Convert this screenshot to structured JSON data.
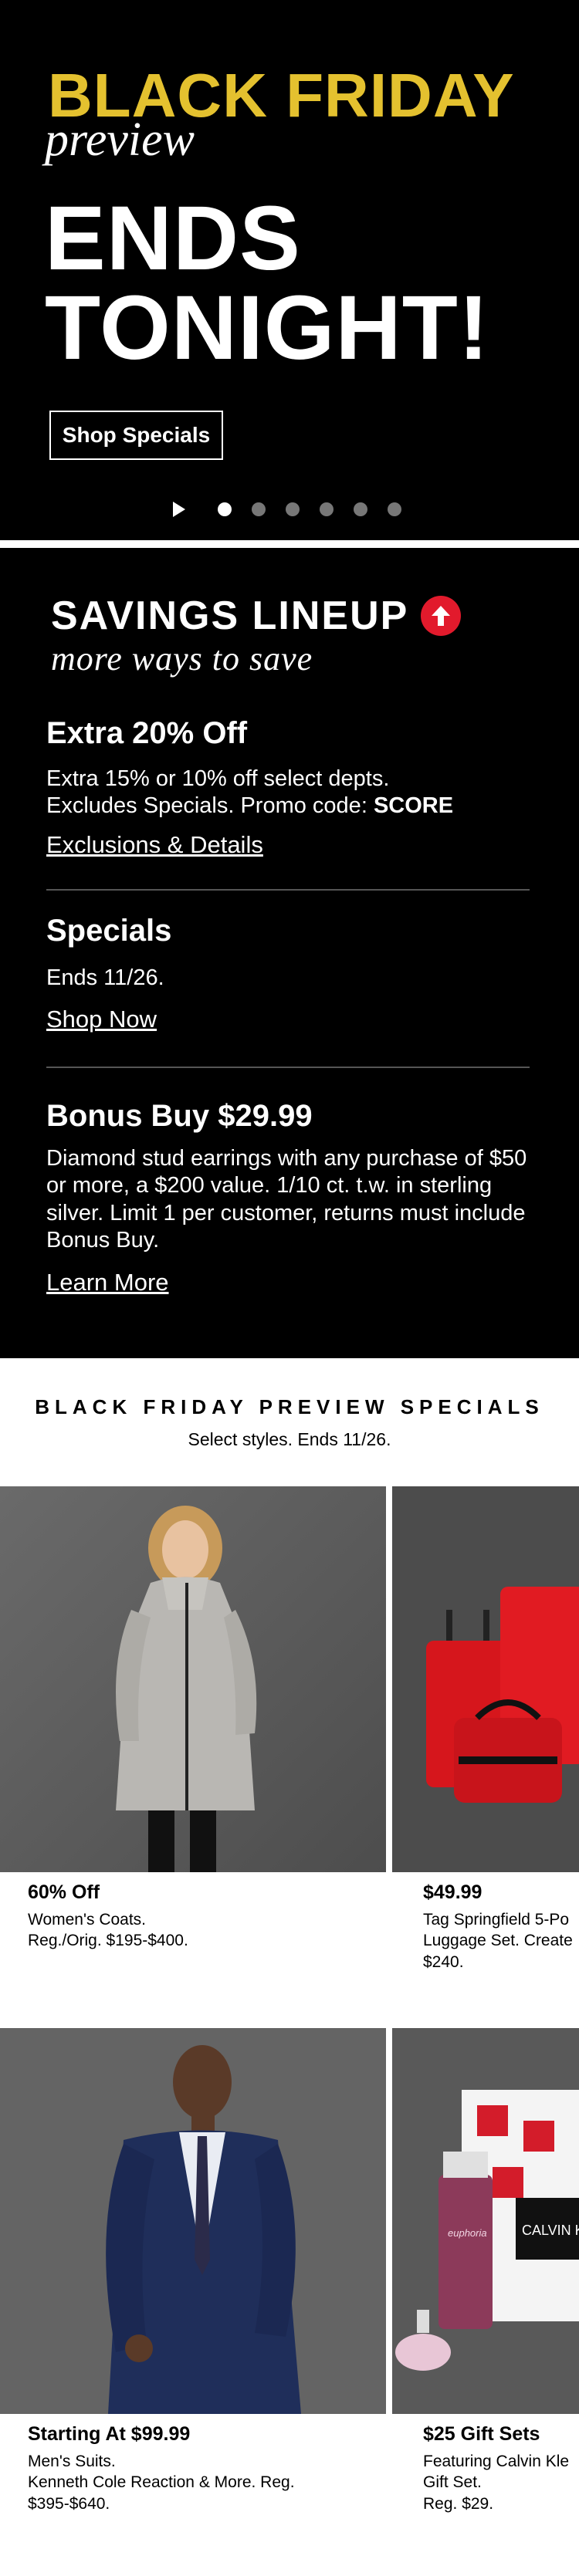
{
  "hero": {
    "title": "BLACK FRIDAY",
    "subtitle": "preview",
    "headline_line1": "ENDS",
    "headline_line2": "TONIGHT!",
    "cta": "Shop Specials",
    "carousel_total": 6,
    "carousel_active": 1
  },
  "savings": {
    "title": "SAVINGS LINEUP",
    "subtitle": "more ways to save",
    "offers": [
      {
        "heading": "Extra 20% Off",
        "line1": "Extra 15% or 10% off select depts.",
        "line2_prefix": "Excludes Specials. Promo code: ",
        "code": "SCORE",
        "link": "Exclusions & Details"
      },
      {
        "heading": "Specials",
        "text": "Ends 11/26.",
        "link": "Shop Now"
      },
      {
        "heading": "Bonus Buy $29.99",
        "text": "Diamond stud earrings with any purchase of $50 or more, a $200 value. 1/10 ct. t.w. in sterling silver. Limit 1 per customer, returns must include Bonus Buy.",
        "link": "Learn More"
      }
    ]
  },
  "specials": {
    "title": "BLACK FRIDAY PREVIEW SPECIALS",
    "subtitle": "Select styles. Ends 11/26."
  },
  "products": [
    {
      "price": "60% Off",
      "desc1": "Women's Coats.",
      "desc2": "Reg./Orig. $195-$400.",
      "desc3": ""
    },
    {
      "price": "$49.99",
      "desc1": "Tag Springfield 5-Po",
      "desc2": "Luggage Set. Create",
      "desc3": "$240."
    },
    {
      "price": "Starting At $99.99",
      "desc1": "Men's Suits.",
      "desc2": "Kenneth Cole Reaction & More. Reg.",
      "desc3": "$395-$640."
    },
    {
      "price": "$25 Gift Sets",
      "desc1": "Featuring Calvin Kle",
      "desc2": "Gift Set.",
      "desc3": "Reg. $29."
    }
  ],
  "product_image_text": {
    "euphoria": "euphoria",
    "calvin": "CALVIN K"
  },
  "colors": {
    "gold": "#e4c12f",
    "accent_red": "#e21a2c",
    "background_dark": "#000000"
  }
}
